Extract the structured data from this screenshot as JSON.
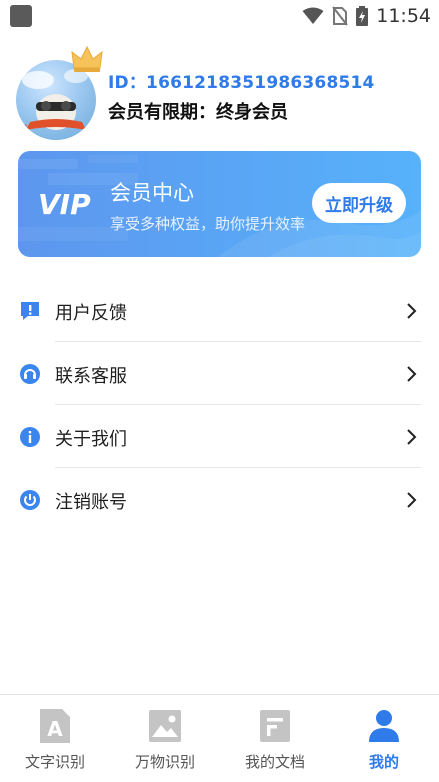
{
  "status_bar": {
    "time": "11:54"
  },
  "profile": {
    "id_text": "ID：1661218351986368514",
    "vip_expiry": "会员有限期：终身会员"
  },
  "vip_banner": {
    "logo_text": "VIP",
    "title": "会员中心",
    "subtitle": "享受多种权益，助你提升效率",
    "upgrade_label": "立即升级"
  },
  "menu": {
    "items": [
      {
        "label": "用户反馈",
        "icon": "feedback-icon"
      },
      {
        "label": "联系客服",
        "icon": "customer-service-icon"
      },
      {
        "label": "关于我们",
        "icon": "info-icon"
      },
      {
        "label": "注销账号",
        "icon": "power-icon"
      }
    ]
  },
  "bottom_nav": {
    "tabs": [
      {
        "label": "文字识别",
        "icon": "text-recognition-icon",
        "active": false
      },
      {
        "label": "万物识别",
        "icon": "image-recognition-icon",
        "active": false
      },
      {
        "label": "我的文档",
        "icon": "document-icon",
        "active": false
      },
      {
        "label": "我的",
        "icon": "profile-icon",
        "active": true
      }
    ]
  },
  "colors": {
    "accent": "#2f7be9",
    "banner_start": "#5d96ee",
    "banner_end": "#57b2fa",
    "inactive_icon": "#c4c4c4"
  }
}
